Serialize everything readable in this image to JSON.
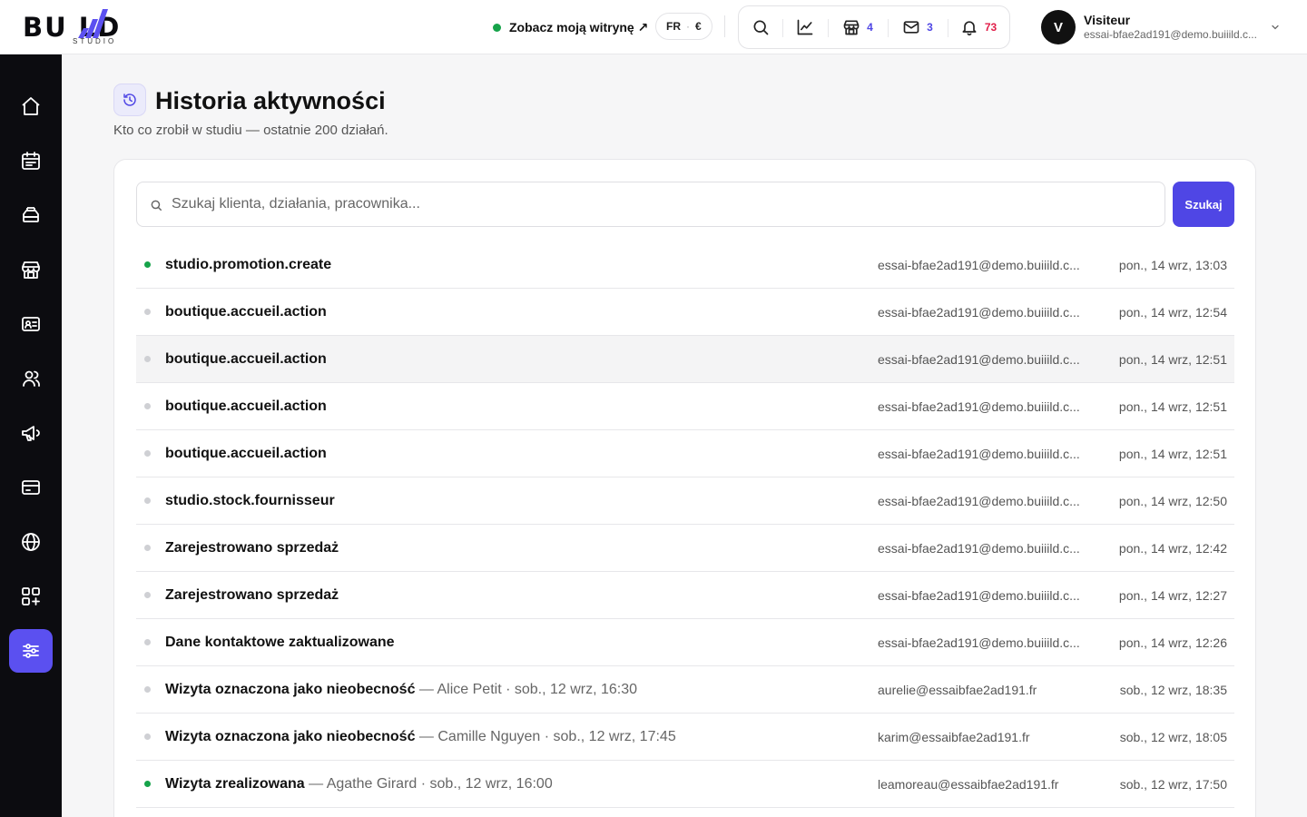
{
  "brand": {
    "logo_text": "BU  LD",
    "logo_sub": "STUDIO"
  },
  "header": {
    "site_link": "Zobacz moją witrynę ↗",
    "lang": "FR",
    "currency": "€",
    "shop_count": "4",
    "mail_count": "3",
    "notif_count": "73",
    "user_initial": "V",
    "user_name": "Visiteur",
    "user_email": "essai-bfae2ad191@demo.buiiild.c..."
  },
  "page": {
    "title": "Historia aktywności",
    "subtitle": "Kto co zrobił w studiu — ostatnie 200 działań."
  },
  "search": {
    "placeholder": "Szukaj klienta, działania, pracownika...",
    "value": "",
    "button": "Szukaj"
  },
  "colors": {
    "accent": "#4f46e5",
    "sidebar": "#0c0c10",
    "success": "#16a34a",
    "alert": "#e11d48"
  },
  "sidebar_icons": [
    "home-icon",
    "calendar-icon",
    "services-icon",
    "shop-icon",
    "contact-card-icon",
    "users-icon",
    "megaphone-icon",
    "payment-card-icon",
    "globe-icon",
    "apps-icon",
    "settings-sliders-icon"
  ],
  "activities": [
    {
      "action": "studio.promotion.create",
      "detail": "",
      "user": "essai-bfae2ad191@demo.buiiild.c...",
      "time": "pon., 14 wrz, 13:03",
      "status": "green"
    },
    {
      "action": "boutique.accueil.action",
      "detail": "",
      "user": "essai-bfae2ad191@demo.buiiild.c...",
      "time": "pon., 14 wrz, 12:54",
      "status": "gray"
    },
    {
      "action": "boutique.accueil.action",
      "detail": "",
      "user": "essai-bfae2ad191@demo.buiiild.c...",
      "time": "pon., 14 wrz, 12:51",
      "status": "gray"
    },
    {
      "action": "boutique.accueil.action",
      "detail": "",
      "user": "essai-bfae2ad191@demo.buiiild.c...",
      "time": "pon., 14 wrz, 12:51",
      "status": "gray"
    },
    {
      "action": "boutique.accueil.action",
      "detail": "",
      "user": "essai-bfae2ad191@demo.buiiild.c...",
      "time": "pon., 14 wrz, 12:51",
      "status": "gray"
    },
    {
      "action": "studio.stock.fournisseur",
      "detail": "",
      "user": "essai-bfae2ad191@demo.buiiild.c...",
      "time": "pon., 14 wrz, 12:50",
      "status": "gray"
    },
    {
      "action": "Zarejestrowano sprzedaż",
      "detail": "",
      "user": "essai-bfae2ad191@demo.buiiild.c...",
      "time": "pon., 14 wrz, 12:42",
      "status": "gray"
    },
    {
      "action": "Zarejestrowano sprzedaż",
      "detail": "",
      "user": "essai-bfae2ad191@demo.buiiild.c...",
      "time": "pon., 14 wrz, 12:27",
      "status": "gray"
    },
    {
      "action": "Dane kontaktowe zaktualizowane",
      "detail": "",
      "user": "essai-bfae2ad191@demo.buiiild.c...",
      "time": "pon., 14 wrz, 12:26",
      "status": "gray"
    },
    {
      "action": "Wizyta oznaczona jako nieobecność",
      "detail": " — Alice Petit · sob., 12 wrz, 16:30",
      "user": "aurelie@essaibfae2ad191.fr",
      "time": "sob., 12 wrz, 18:35",
      "status": "gray"
    },
    {
      "action": "Wizyta oznaczona jako nieobecność",
      "detail": " — Camille Nguyen · sob., 12 wrz, 17:45",
      "user": "karim@essaibfae2ad191.fr",
      "time": "sob., 12 wrz, 18:05",
      "status": "gray"
    },
    {
      "action": "Wizyta zrealizowana",
      "detail": " — Agathe Girard · sob., 12 wrz, 16:00",
      "user": "leamoreau@essaibfae2ad191.fr",
      "time": "sob., 12 wrz, 17:50",
      "status": "green"
    }
  ]
}
